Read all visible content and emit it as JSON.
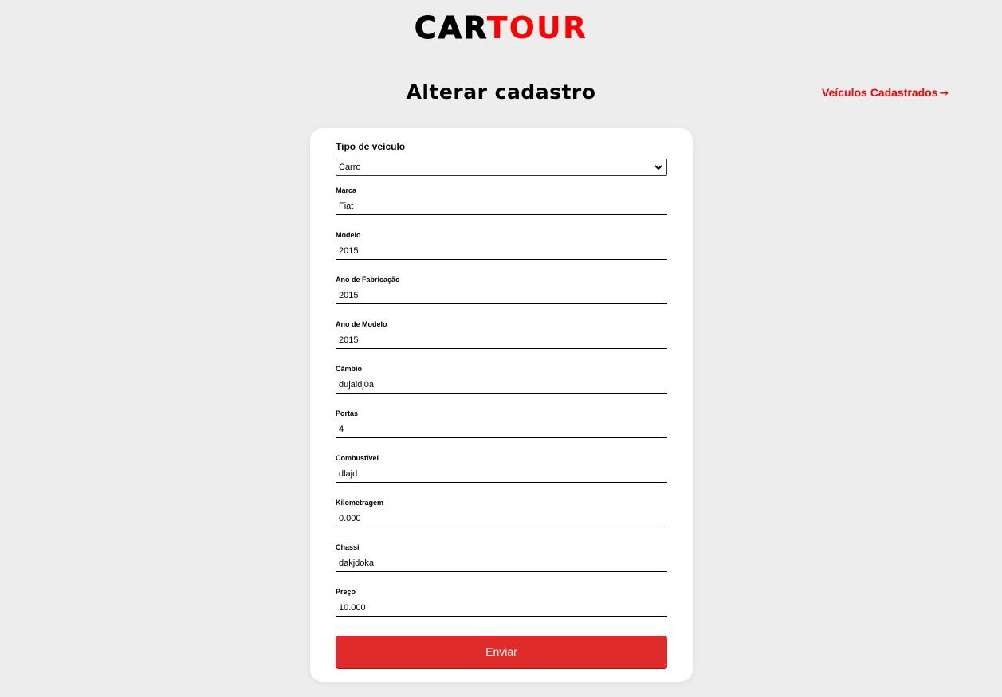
{
  "header": {
    "logo_part1": "CAR",
    "logo_part2": "TOUR",
    "title": "Alterar cadastro",
    "nav_link": "Veículos Cadastrados",
    "nav_arrow": "arrow-right-icon"
  },
  "form": {
    "type_label": "Tipo de veículo",
    "type_value": "Carro",
    "fields": [
      {
        "label": "Marca",
        "value": "Fiat"
      },
      {
        "label": "Modelo",
        "value": "2015"
      },
      {
        "label": "Ano de Fabricação",
        "value": "2015"
      },
      {
        "label": "Ano de Modelo",
        "value": "2015"
      },
      {
        "label": "Câmbio",
        "value": "dujaidj0a"
      },
      {
        "label": "Portas",
        "value": "4"
      },
      {
        "label": "Combustível",
        "value": "dlajd"
      },
      {
        "label": "Kilometragem",
        "value": "0.000"
      },
      {
        "label": "Chassi",
        "value": "dakjdoka"
      },
      {
        "label": "Preço",
        "value": "10.000"
      }
    ],
    "submit_label": "Enviar"
  },
  "colors": {
    "accent": "#ff0000",
    "button": "#e02b2b",
    "background": "#ededed"
  }
}
